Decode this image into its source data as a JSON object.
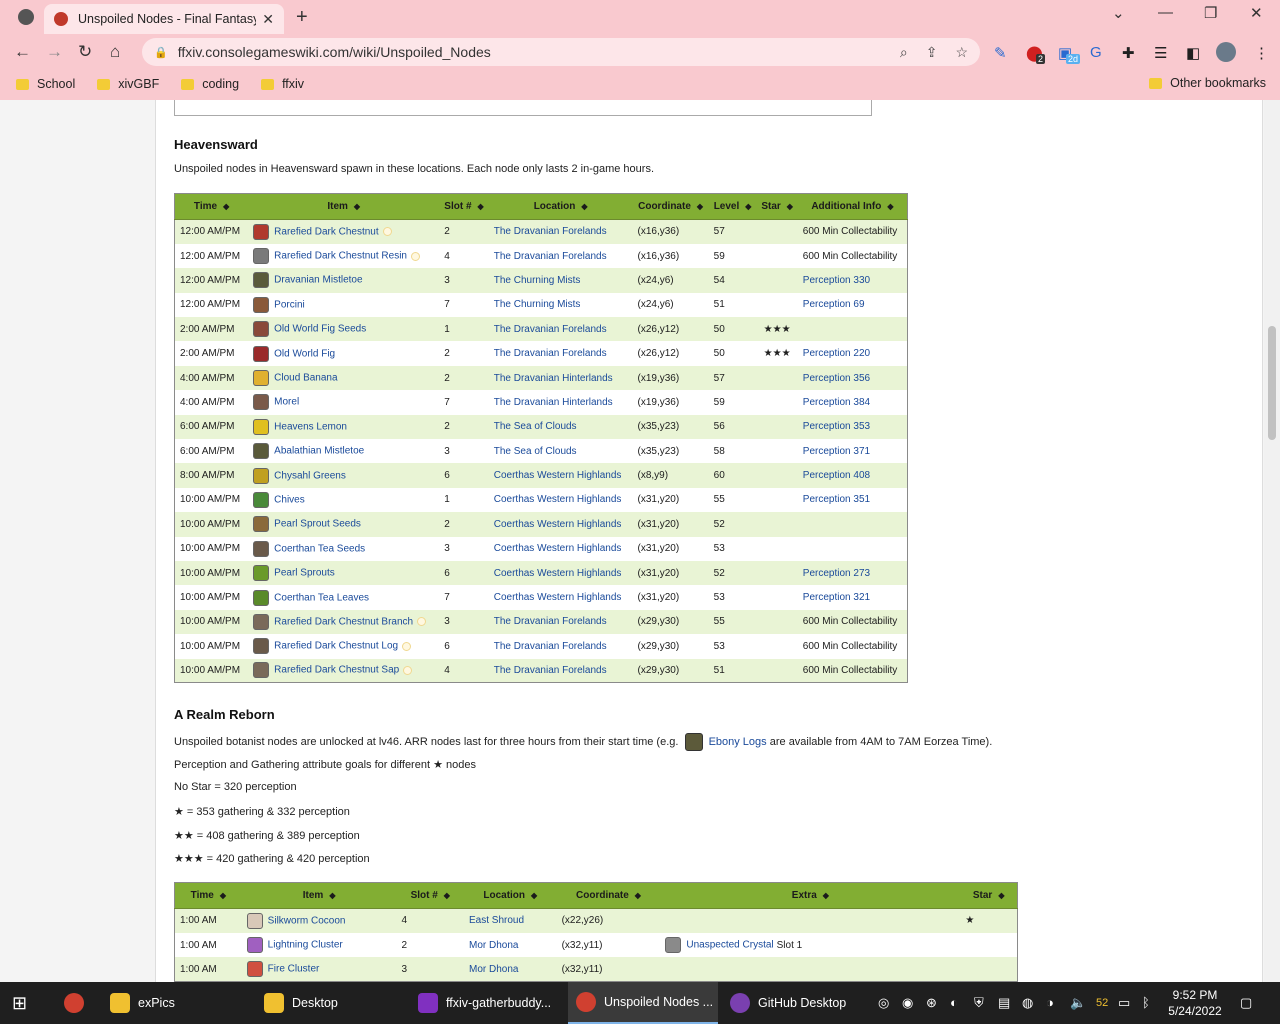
{
  "browser": {
    "tab_title": "Unspoiled Nodes - Final Fantasy",
    "url": "ffxiv.consolegameswiki.com/wiki/Unspoiled_Nodes",
    "bookmarks": [
      "School",
      "xivGBF",
      "coding",
      "ffxiv"
    ],
    "other_bookmarks": "Other bookmarks",
    "ext_badge_1": "2",
    "ext_badge_2": "2d"
  },
  "heavensward": {
    "heading": "Heavensward",
    "intro": "Unspoiled nodes in Heavensward spawn in these locations. Each node only lasts 2 in-game hours.",
    "columns": [
      "Time",
      "Item",
      "Slot #",
      "Location",
      "Coordinate",
      "Level",
      "Star",
      "Additional Info"
    ],
    "rows": [
      {
        "time": "12:00 AM/PM",
        "item": "Rarefied Dark Chestnut",
        "hq": true,
        "slot": "2",
        "location": "The Dravanian Forelands",
        "coord": "(x16,y36)",
        "level": "57",
        "star": "",
        "info": "600 Min Collectability",
        "info_link": false,
        "color": "#b03a2e"
      },
      {
        "time": "12:00 AM/PM",
        "item": "Rarefied Dark Chestnut Resin",
        "hq": true,
        "slot": "4",
        "location": "The Dravanian Forelands",
        "coord": "(x16,y36)",
        "level": "59",
        "star": "",
        "info": "600 Min Collectability",
        "info_link": false,
        "color": "#7a7a7a"
      },
      {
        "time": "12:00 AM/PM",
        "item": "Dravanian Mistletoe",
        "hq": false,
        "slot": "3",
        "location": "The Churning Mists",
        "coord": "(x24,y6)",
        "level": "54",
        "star": "",
        "info": "Perception 330",
        "info_link": true,
        "color": "#5a5a3a"
      },
      {
        "time": "12:00 AM/PM",
        "item": "Porcini",
        "hq": false,
        "slot": "7",
        "location": "The Churning Mists",
        "coord": "(x24,y6)",
        "level": "51",
        "star": "",
        "info": "Perception 69",
        "info_link": true,
        "color": "#8a5a3a"
      },
      {
        "time": "2:00 AM/PM",
        "item": "Old World Fig Seeds",
        "hq": false,
        "slot": "1",
        "location": "The Dravanian Forelands",
        "coord": "(x26,y12)",
        "level": "50",
        "star": "★★★",
        "info": "",
        "info_link": false,
        "color": "#8a4a3a"
      },
      {
        "time": "2:00 AM/PM",
        "item": "Old World Fig",
        "hq": false,
        "slot": "2",
        "location": "The Dravanian Forelands",
        "coord": "(x26,y12)",
        "level": "50",
        "star": "★★★",
        "info": "Perception 220",
        "info_link": true,
        "color": "#9a2a2a"
      },
      {
        "time": "4:00 AM/PM",
        "item": "Cloud Banana",
        "hq": false,
        "slot": "2",
        "location": "The Dravanian Hinterlands",
        "coord": "(x19,y36)",
        "level": "57",
        "star": "",
        "info": "Perception 356",
        "info_link": true,
        "color": "#e0b030"
      },
      {
        "time": "4:00 AM/PM",
        "item": "Morel",
        "hq": false,
        "slot": "7",
        "location": "The Dravanian Hinterlands",
        "coord": "(x19,y36)",
        "level": "59",
        "star": "",
        "info": "Perception 384",
        "info_link": true,
        "color": "#7a5a4a"
      },
      {
        "time": "6:00 AM/PM",
        "item": "Heavens Lemon",
        "hq": false,
        "slot": "2",
        "location": "The Sea of Clouds",
        "coord": "(x35,y23)",
        "level": "56",
        "star": "",
        "info": "Perception 353",
        "info_link": true,
        "color": "#e0c020"
      },
      {
        "time": "6:00 AM/PM",
        "item": "Abalathian Mistletoe",
        "hq": false,
        "slot": "3",
        "location": "The Sea of Clouds",
        "coord": "(x35,y23)",
        "level": "58",
        "star": "",
        "info": "Perception 371",
        "info_link": true,
        "color": "#5a5a3a"
      },
      {
        "time": "8:00 AM/PM",
        "item": "Chysahl Greens",
        "hq": false,
        "slot": "6",
        "location": "Coerthas Western Highlands",
        "coord": "(x8,y9)",
        "level": "60",
        "star": "",
        "info": "Perception 408",
        "info_link": true,
        "color": "#c0a020"
      },
      {
        "time": "10:00 AM/PM",
        "item": "Chives",
        "hq": false,
        "slot": "1",
        "location": "Coerthas Western Highlands",
        "coord": "(x31,y20)",
        "level": "55",
        "star": "",
        "info": "Perception 351",
        "info_link": true,
        "color": "#4a8a3a"
      },
      {
        "time": "10:00 AM/PM",
        "item": "Pearl Sprout Seeds",
        "hq": false,
        "slot": "2",
        "location": "Coerthas Western Highlands",
        "coord": "(x31,y20)",
        "level": "52",
        "star": "",
        "info": "",
        "info_link": false,
        "color": "#8a6a3a"
      },
      {
        "time": "10:00 AM/PM",
        "item": "Coerthan Tea Seeds",
        "hq": false,
        "slot": "3",
        "location": "Coerthas Western Highlands",
        "coord": "(x31,y20)",
        "level": "53",
        "star": "",
        "info": "",
        "info_link": false,
        "color": "#6a5a4a"
      },
      {
        "time": "10:00 AM/PM",
        "item": "Pearl Sprouts",
        "hq": false,
        "slot": "6",
        "location": "Coerthas Western Highlands",
        "coord": "(x31,y20)",
        "level": "52",
        "star": "",
        "info": "Perception 273",
        "info_link": true,
        "color": "#6a9a2a"
      },
      {
        "time": "10:00 AM/PM",
        "item": "Coerthan Tea Leaves",
        "hq": false,
        "slot": "7",
        "location": "Coerthas Western Highlands",
        "coord": "(x31,y20)",
        "level": "53",
        "star": "",
        "info": "Perception 321",
        "info_link": true,
        "color": "#5a8a2a"
      },
      {
        "time": "10:00 AM/PM",
        "item": "Rarefied Dark Chestnut Branch",
        "hq": true,
        "slot": "3",
        "location": "The Dravanian Forelands",
        "coord": "(x29,y30)",
        "level": "55",
        "star": "",
        "info": "600 Min Collectability",
        "info_link": false,
        "color": "#7a6a5a"
      },
      {
        "time": "10:00 AM/PM",
        "item": "Rarefied Dark Chestnut Log",
        "hq": true,
        "slot": "6",
        "location": "The Dravanian Forelands",
        "coord": "(x29,y30)",
        "level": "53",
        "star": "",
        "info": "600 Min Collectability",
        "info_link": false,
        "color": "#6a5a4a"
      },
      {
        "time": "10:00 AM/PM",
        "item": "Rarefied Dark Chestnut Sap",
        "hq": true,
        "slot": "4",
        "location": "The Dravanian Forelands",
        "coord": "(x29,y30)",
        "level": "51",
        "star": "",
        "info": "600 Min Collectability",
        "info_link": false,
        "color": "#7a6a5a"
      }
    ]
  },
  "arr": {
    "heading": "A Realm Reborn",
    "intro_before": "Unspoiled botanist nodes are unlocked at lv46. ARR nodes last for three hours from their start time (e.g.",
    "intro_link": "Ebony Logs",
    "intro_after": "are available from 4AM to 7AM Eorzea Time).",
    "goals_title": "Perception and Gathering attribute goals for different ★ nodes",
    "goals": [
      "No Star = 320 perception",
      "★ = 353 gathering & 332 perception",
      "★★ = 408 gathering & 389 perception",
      "★★★ = 420 gathering & 420 perception"
    ],
    "columns": [
      "Time",
      "Item",
      "Slot #",
      "Location",
      "Coordinate",
      "Extra",
      "Star"
    ],
    "rows": [
      {
        "time": "1:00 AM",
        "item": "Silkworm Cocoon",
        "slot": "4",
        "location": "East Shroud",
        "coord": "(x22,y26)",
        "extra_link": "",
        "extra_text": "",
        "star": "★",
        "color": "#d8c8b8"
      },
      {
        "time": "1:00 AM",
        "item": "Lightning Cluster",
        "slot": "2",
        "location": "Mor Dhona",
        "coord": "(x32,y11)",
        "extra_link": "Unaspected Crystal",
        "extra_text": "Slot 1",
        "star": "",
        "color": "#a060c0"
      },
      {
        "time": "1:00 AM",
        "item": "Fire Cluster",
        "slot": "3",
        "location": "Mor Dhona",
        "coord": "(x32,y11)",
        "extra_link": "",
        "extra_text": "",
        "star": "",
        "color": "#d05040"
      }
    ]
  },
  "taskbar": {
    "items": [
      "exPics",
      "Desktop",
      "ffxiv-gatherbuddy...",
      "Unspoiled Nodes ...",
      "GitHub Desktop"
    ],
    "temp": "52",
    "time": "9:52 PM",
    "date": "5/24/2022"
  }
}
